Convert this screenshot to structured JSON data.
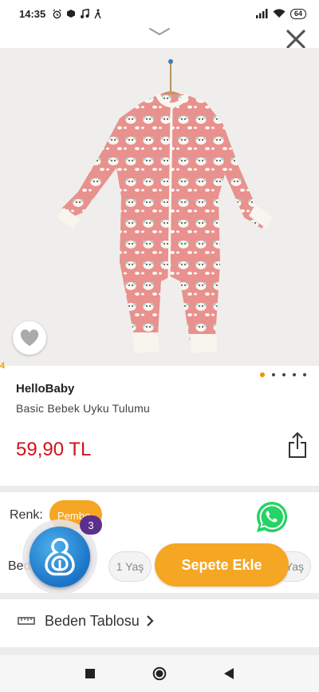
{
  "status_bar": {
    "time": "14:35",
    "battery": "64",
    "icons": [
      "alarm-icon",
      "box-icon",
      "music-icon",
      "walk-icon",
      "signal-icon",
      "wifi-icon",
      "battery-icon"
    ]
  },
  "product": {
    "brand": "HelloBaby",
    "name": "Basic Bebek Uyku Tulumu",
    "price": "59,90 TL",
    "image_index": "4",
    "gallery_dots": 5,
    "active_dot": 0
  },
  "options": {
    "color_label": "Renk:",
    "color_value": "Pembe",
    "size_label": "Beden:",
    "sizes": [
      "1 Yaş",
      "2 Yaş"
    ]
  },
  "cart": {
    "add_label": "Sepete Ekle"
  },
  "floating": {
    "badge_count": "3"
  },
  "size_table": {
    "label": "Beden Tablosu"
  },
  "colors": {
    "accent": "#f5a623",
    "price": "#d0121b",
    "whatsapp": "#25d366",
    "fab": "#1a73c7",
    "badge": "#5b2f8c"
  }
}
